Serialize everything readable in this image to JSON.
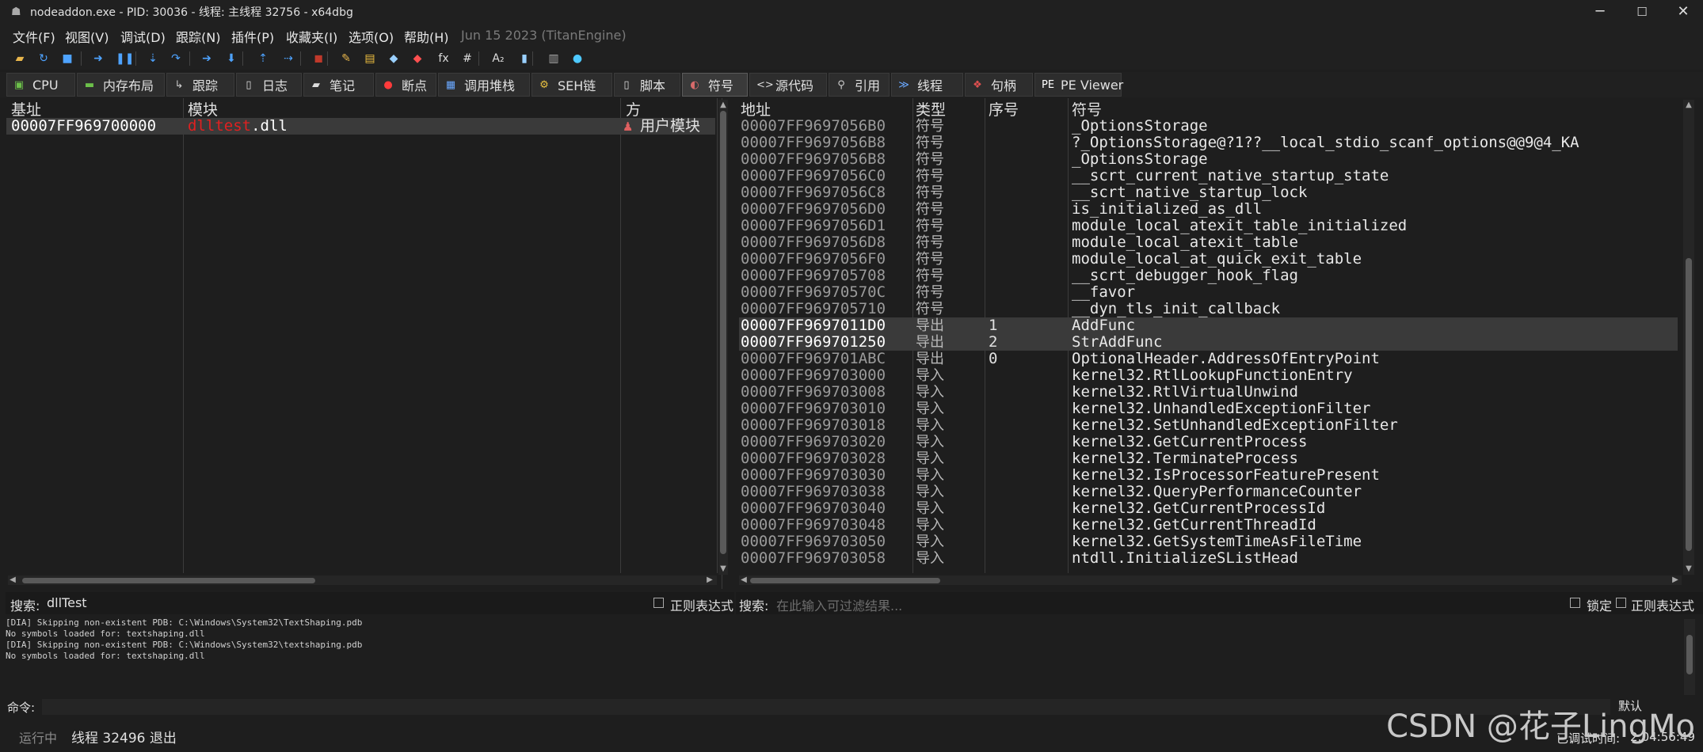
{
  "window": {
    "title": "nodeaddon.exe - PID: 30036 - 线程: 主线程 32756 - x64dbg",
    "minimize_glyph": "─",
    "maximize_glyph": "☐",
    "close_glyph": "✕"
  },
  "menu": {
    "items": [
      "文件(F)",
      "视图(V)",
      "调试(D)",
      "跟踪(N)",
      "插件(P)",
      "收藏夹(I)",
      "选项(O)",
      "帮助(H)"
    ],
    "info": "Jun 15 2023 (TitanEngine)"
  },
  "toolbar": {
    "icons": [
      {
        "name": "open-icon",
        "glyph": "▰",
        "color": "#e8b64c"
      },
      {
        "name": "restart-icon",
        "glyph": "↻",
        "color": "#4ea3ff"
      },
      {
        "name": "stop-icon",
        "glyph": "■",
        "color": "#4ea3ff"
      },
      {
        "name": "run-icon",
        "glyph": "➜",
        "color": "#4ea3ff"
      },
      {
        "name": "pause-icon",
        "glyph": "❚❚",
        "color": "#4ea3ff"
      },
      {
        "name": "step-into-icon",
        "glyph": "⇣",
        "color": "#4ea3ff"
      },
      {
        "name": "step-over-icon",
        "glyph": "↷",
        "color": "#4ea3ff"
      },
      {
        "name": "trace-into-icon",
        "glyph": "➔",
        "color": "#4ea3ff"
      },
      {
        "name": "trace-over-icon",
        "glyph": "⬇",
        "color": "#4ea3ff"
      },
      {
        "name": "execute-till-return-icon",
        "glyph": "⇡",
        "color": "#4ea3ff"
      },
      {
        "name": "run-to-user-code-icon",
        "glyph": "⇢",
        "color": "#4ea3ff"
      },
      {
        "name": "scylla-icon",
        "glyph": "◼",
        "color": "#c0392b"
      },
      {
        "name": "patch-icon",
        "glyph": "✎",
        "color": "#e8b64c"
      },
      {
        "name": "comments-icon",
        "glyph": "▤",
        "color": "#f0c040"
      },
      {
        "name": "labels-icon",
        "glyph": "◆",
        "color": "#9ad0ff"
      },
      {
        "name": "bookmarks-icon",
        "glyph": "◆",
        "color": "#ff5050"
      },
      {
        "name": "functions-icon",
        "glyph": "fx",
        "color": "#dddddd"
      },
      {
        "name": "variables-icon",
        "glyph": "#",
        "color": "#dddddd"
      },
      {
        "name": "strings-icon",
        "glyph": "A₂",
        "color": "#dddddd"
      },
      {
        "name": "calculator-icon",
        "glyph": "▮",
        "color": "#9ad0ff"
      },
      {
        "name": "notes-icon",
        "glyph": "▥",
        "color": "#aaaaaa"
      },
      {
        "name": "help-icon",
        "glyph": "●",
        "color": "#4ec9ff"
      }
    ]
  },
  "tabs": [
    {
      "label": "CPU",
      "icon": "cpu-icon",
      "glyph": "▣",
      "color": "#6cc04a"
    },
    {
      "label": "内存布局",
      "icon": "memory-map-icon",
      "glyph": "▬",
      "color": "#6cc04a"
    },
    {
      "label": "跟踪",
      "icon": "trace-icon",
      "glyph": "↳",
      "color": "#cccccc"
    },
    {
      "label": "日志",
      "icon": "log-icon",
      "glyph": "▯",
      "color": "#dddddd"
    },
    {
      "label": "笔记",
      "icon": "notes-tab-icon",
      "glyph": "▰",
      "color": "#dddddd"
    },
    {
      "label": "断点",
      "icon": "breakpoints-icon",
      "glyph": "●",
      "color": "#ff3b3b"
    },
    {
      "label": "调用堆栈",
      "icon": "call-stack-icon",
      "glyph": "▦",
      "color": "#6aa8ff"
    },
    {
      "label": "SEH链",
      "icon": "seh-chain-icon",
      "glyph": "⚙",
      "color": "#e8c040"
    },
    {
      "label": "脚本",
      "icon": "script-icon",
      "glyph": "▯",
      "color": "#dddddd"
    },
    {
      "label": "符号",
      "icon": "symbols-icon",
      "glyph": "◐",
      "color": "#d86a6a"
    },
    {
      "label": "源代码",
      "icon": "source-icon",
      "glyph": "<>",
      "color": "#dddddd"
    },
    {
      "label": "引用",
      "icon": "references-icon",
      "glyph": "⚲",
      "color": "#cccccc"
    },
    {
      "label": "线程",
      "icon": "threads-icon",
      "glyph": "≫",
      "color": "#6aa8ff"
    },
    {
      "label": "句柄",
      "icon": "handles-icon",
      "glyph": "❖",
      "color": "#e05050"
    },
    {
      "label": "PE Viewer",
      "icon": "pe-viewer-icon",
      "glyph": "PE",
      "color": "#ffffff"
    }
  ],
  "active_tab": "符号",
  "modules_panel": {
    "headers": {
      "base": "基址",
      "module": "模块",
      "party": "方"
    },
    "rows": [
      {
        "base": "00007FF969700000",
        "module_highlight": "dlltest",
        "module_rest": ".dll",
        "party": "用户模块"
      }
    ],
    "search_label": "搜索:",
    "search_value": "dllTest",
    "regex_label": "正则表达式"
  },
  "symbols_panel": {
    "headers": {
      "address": "地址",
      "type": "类型",
      "ordinal": "序号",
      "symbol": "符号"
    },
    "rows": [
      {
        "address": "00007FF9697056B0",
        "type": "符号",
        "ordinal": "",
        "symbol": "_OptionsStorage",
        "highlight": false
      },
      {
        "address": "00007FF9697056B8",
        "type": "符号",
        "ordinal": "",
        "symbol": "?_OptionsStorage@?1??__local_stdio_scanf_options@@9@4_KA",
        "highlight": false
      },
      {
        "address": "00007FF9697056B8",
        "type": "符号",
        "ordinal": "",
        "symbol": "_OptionsStorage",
        "highlight": false
      },
      {
        "address": "00007FF9697056C0",
        "type": "符号",
        "ordinal": "",
        "symbol": "__scrt_current_native_startup_state",
        "highlight": false
      },
      {
        "address": "00007FF9697056C8",
        "type": "符号",
        "ordinal": "",
        "symbol": "__scrt_native_startup_lock",
        "highlight": false
      },
      {
        "address": "00007FF9697056D0",
        "type": "符号",
        "ordinal": "",
        "symbol": "is_initialized_as_dll",
        "highlight": false
      },
      {
        "address": "00007FF9697056D1",
        "type": "符号",
        "ordinal": "",
        "symbol": "module_local_atexit_table_initialized",
        "highlight": false
      },
      {
        "address": "00007FF9697056D8",
        "type": "符号",
        "ordinal": "",
        "symbol": "module_local_atexit_table",
        "highlight": false
      },
      {
        "address": "00007FF9697056F0",
        "type": "符号",
        "ordinal": "",
        "symbol": "module_local_at_quick_exit_table",
        "highlight": false
      },
      {
        "address": "00007FF969705708",
        "type": "符号",
        "ordinal": "",
        "symbol": "__scrt_debugger_hook_flag",
        "highlight": false
      },
      {
        "address": "00007FF96970570C",
        "type": "符号",
        "ordinal": "",
        "symbol": "__favor",
        "highlight": false
      },
      {
        "address": "00007FF969705710",
        "type": "符号",
        "ordinal": "",
        "symbol": "__dyn_tls_init_callback",
        "highlight": false
      },
      {
        "address": "00007FF9697011D0",
        "type": "导出",
        "ordinal": "1",
        "symbol": "AddFunc",
        "highlight": true
      },
      {
        "address": "00007FF969701250",
        "type": "导出",
        "ordinal": "2",
        "symbol": "StrAddFunc",
        "highlight": true
      },
      {
        "address": "00007FF969701ABC",
        "type": "导出",
        "ordinal": "0",
        "symbol": "OptionalHeader.AddressOfEntryPoint",
        "highlight": false
      },
      {
        "address": "00007FF969703000",
        "type": "导入",
        "ordinal": "",
        "symbol": "kernel32.RtlLookupFunctionEntry",
        "highlight": false
      },
      {
        "address": "00007FF969703008",
        "type": "导入",
        "ordinal": "",
        "symbol": "kernel32.RtlVirtualUnwind",
        "highlight": false
      },
      {
        "address": "00007FF969703010",
        "type": "导入",
        "ordinal": "",
        "symbol": "kernel32.UnhandledExceptionFilter",
        "highlight": false
      },
      {
        "address": "00007FF969703018",
        "type": "导入",
        "ordinal": "",
        "symbol": "kernel32.SetUnhandledExceptionFilter",
        "highlight": false
      },
      {
        "address": "00007FF969703020",
        "type": "导入",
        "ordinal": "",
        "symbol": "kernel32.GetCurrentProcess",
        "highlight": false
      },
      {
        "address": "00007FF969703028",
        "type": "导入",
        "ordinal": "",
        "symbol": "kernel32.TerminateProcess",
        "highlight": false
      },
      {
        "address": "00007FF969703030",
        "type": "导入",
        "ordinal": "",
        "symbol": "kernel32.IsProcessorFeaturePresent",
        "highlight": false
      },
      {
        "address": "00007FF969703038",
        "type": "导入",
        "ordinal": "",
        "symbol": "kernel32.QueryPerformanceCounter",
        "highlight": false
      },
      {
        "address": "00007FF969703040",
        "type": "导入",
        "ordinal": "",
        "symbol": "kernel32.GetCurrentProcessId",
        "highlight": false
      },
      {
        "address": "00007FF969703048",
        "type": "导入",
        "ordinal": "",
        "symbol": "kernel32.GetCurrentThreadId",
        "highlight": false
      },
      {
        "address": "00007FF969703050",
        "type": "导入",
        "ordinal": "",
        "symbol": "kernel32.GetSystemTimeAsFileTime",
        "highlight": false
      },
      {
        "address": "00007FF969703058",
        "type": "导入",
        "ordinal": "",
        "symbol": "ntdll.InitializeSListHead",
        "highlight": false
      }
    ],
    "search_label": "搜索:",
    "search_placeholder": "在此输入可过滤结果...",
    "lock_label": "锁定",
    "regex_label": "正则表达式"
  },
  "log": {
    "lines": [
      "[DIA] Skipping non-existent PDB: C:\\Windows\\System32\\TextShaping.pdb",
      "No symbols loaded for: textshaping.dll",
      "[DIA] Skipping non-existent PDB: C:\\Windows\\System32\\textshaping.pdb",
      "No symbols loaded for: textshaping.dll"
    ]
  },
  "command": {
    "label": "命令:",
    "default_label": "默认"
  },
  "status": {
    "state": "运行中",
    "message": "线程 32496 退出",
    "time_label": "已调试时间:",
    "time_value": "2:04:56:49"
  },
  "watermark": "CSDN @花子LingMo"
}
